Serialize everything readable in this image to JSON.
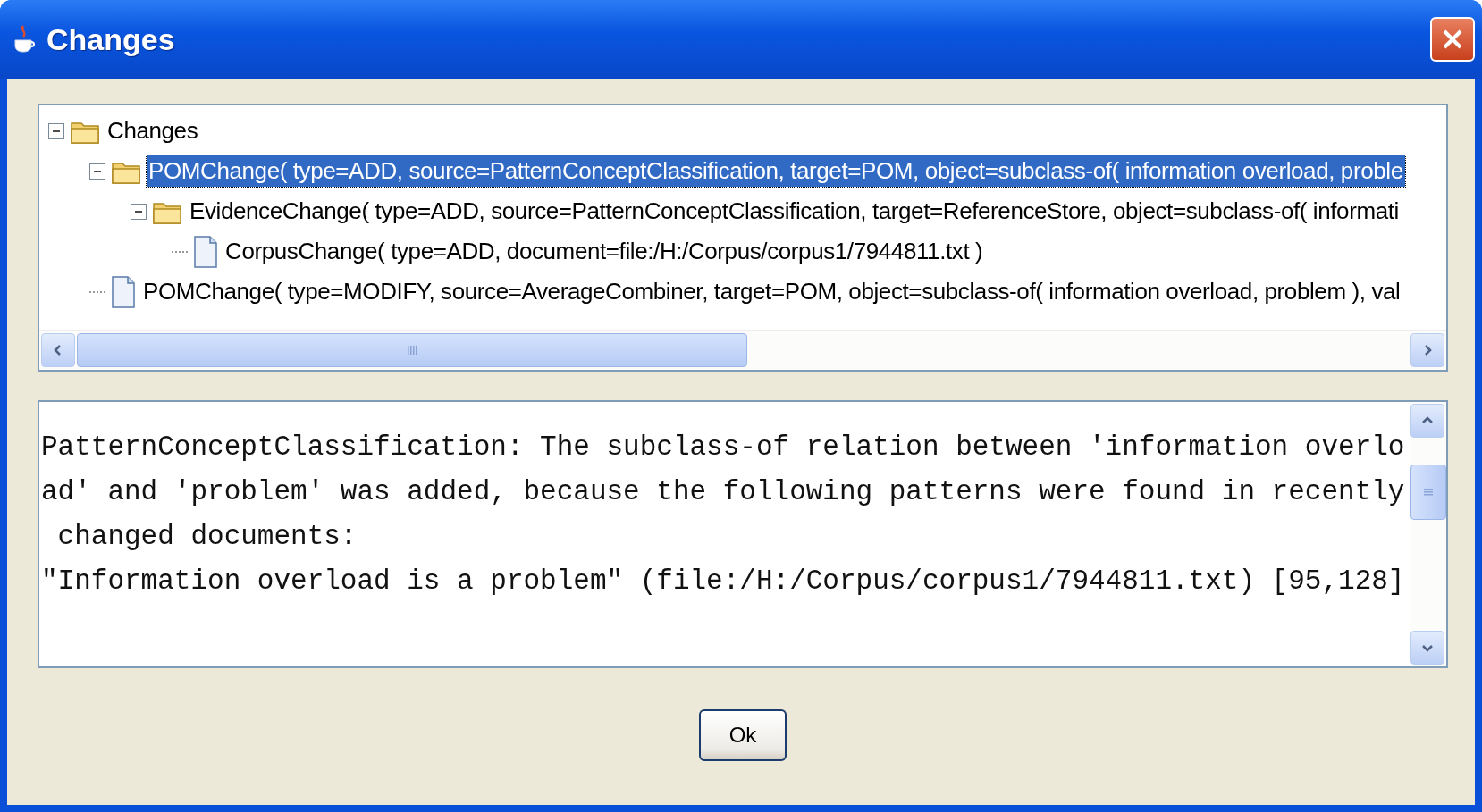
{
  "window": {
    "title": "Changes"
  },
  "tree": {
    "items": [
      {
        "label": "Changes",
        "expanded": true,
        "selected": false,
        "children": [
          {
            "label": "POMChange( type=ADD, source=PatternConceptClassification, target=POM, object=subclass-of( information overload, proble",
            "expanded": true,
            "selected": true,
            "children": [
              {
                "label": "EvidenceChange( type=ADD, source=PatternConceptClassification, target=ReferenceStore, object=subclass-of( informati",
                "expanded": true,
                "selected": false,
                "children": [
                  {
                    "label": "CorpusChange( type=ADD, document=file:/H:/Corpus/corpus1/7944811.txt )",
                    "selected": false
                  }
                ]
              }
            ]
          },
          {
            "label": "POMChange( type=MODIFY, source=AverageCombiner, target=POM, object=subclass-of( information overload, problem ), val",
            "selected": false
          }
        ]
      }
    ]
  },
  "details": {
    "lines": [
      "PatternConceptClassification: The subclass-of relation between 'information overlo",
      "ad' and 'problem' was added, because the following patterns were found in recently",
      " changed documents:",
      "\"Information overload is a problem\" (file:/H:/Corpus/corpus1/7944811.txt) [95,128]"
    ]
  },
  "buttons": [
    {
      "label": "Ok"
    }
  ]
}
